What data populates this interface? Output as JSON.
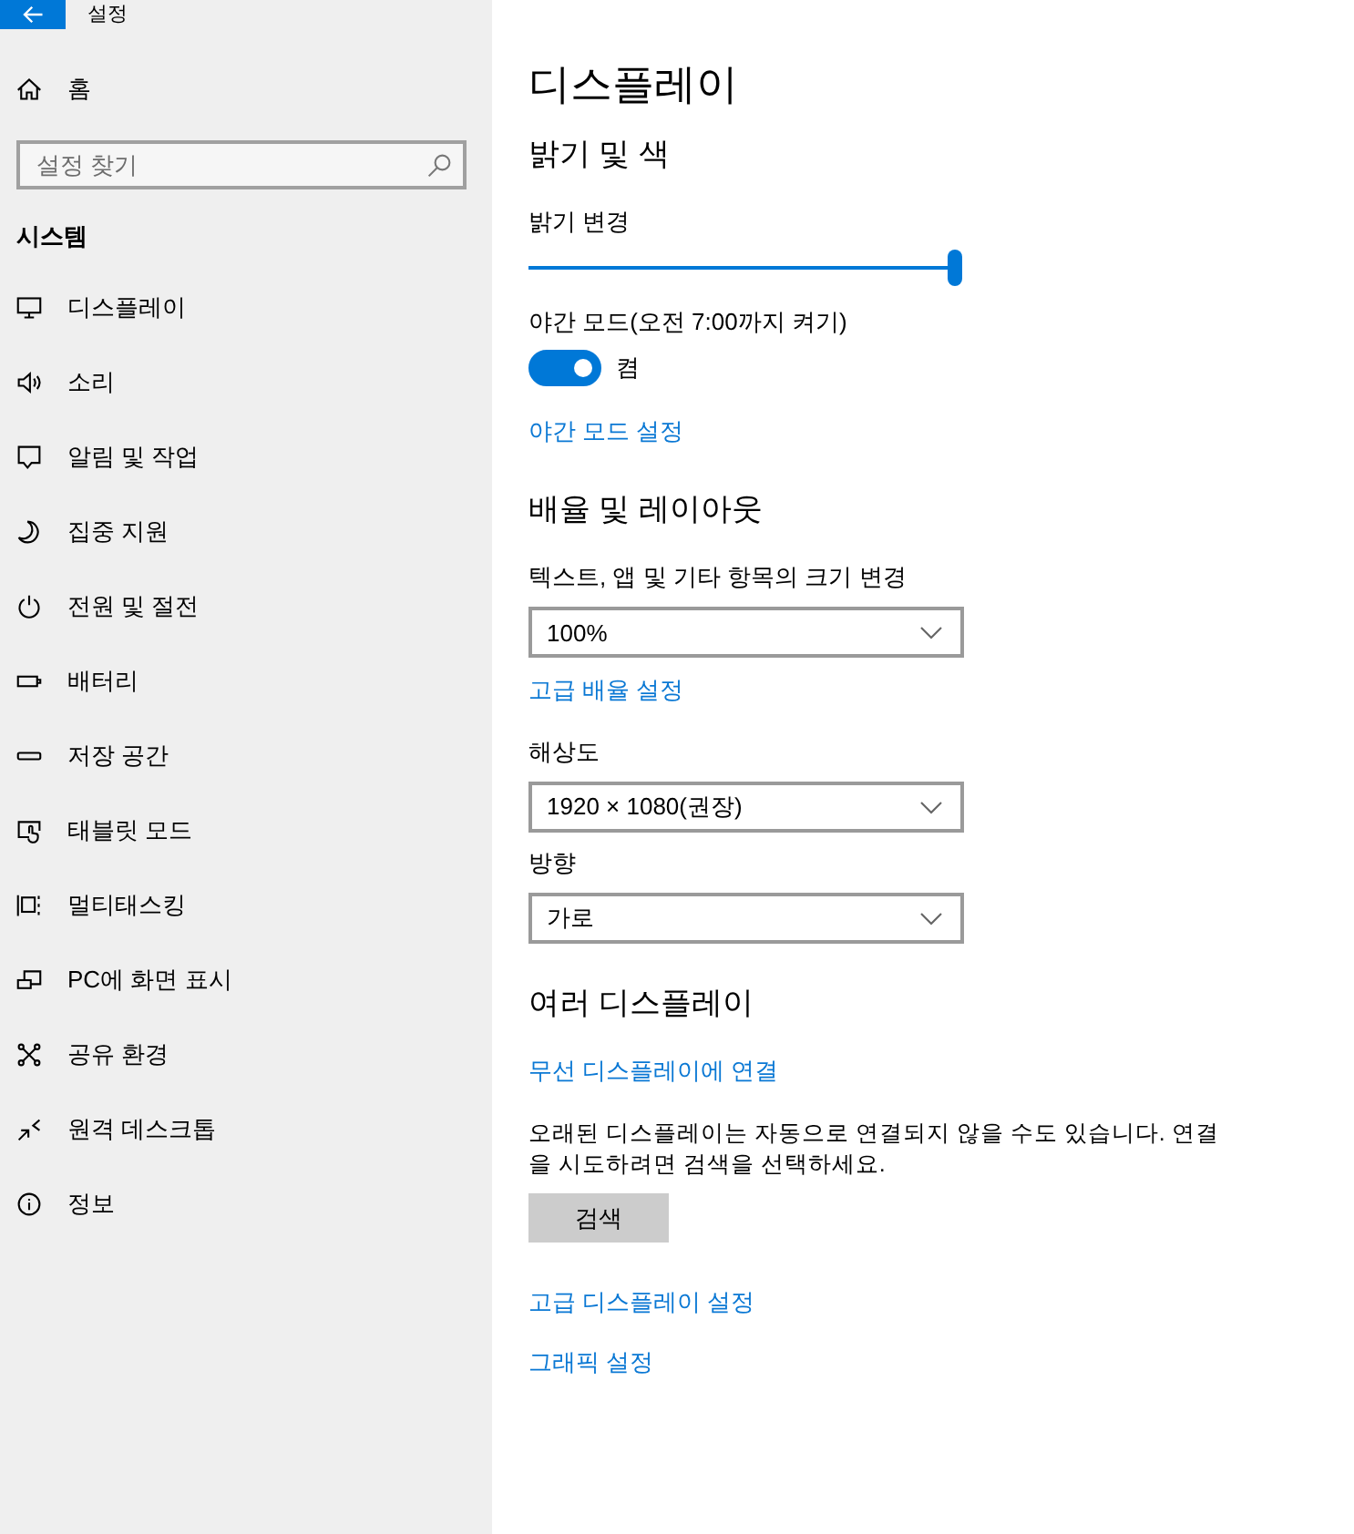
{
  "window": {
    "title": "설정"
  },
  "sidebar": {
    "home": "홈",
    "search": {
      "placeholder": "설정 찾기"
    },
    "section": "시스템",
    "items": [
      {
        "label": "디스플레이"
      },
      {
        "label": "소리"
      },
      {
        "label": "알림 및 작업"
      },
      {
        "label": "집중 지원"
      },
      {
        "label": "전원 및 절전"
      },
      {
        "label": "배터리"
      },
      {
        "label": "저장 공간"
      },
      {
        "label": "태블릿 모드"
      },
      {
        "label": "멀티태스킹"
      },
      {
        "label": "PC에 화면 표시"
      },
      {
        "label": "공유 환경"
      },
      {
        "label": "원격 데스크톱"
      },
      {
        "label": "정보"
      }
    ]
  },
  "page": {
    "title": "디스플레이",
    "sections": [
      {
        "heading": "밝기 및 색",
        "items": [
          {
            "kind": "slider",
            "label": "밝기 변경",
            "level": 1.0
          },
          {
            "kind": "toggle",
            "label": "야간 모드(오전 7:00까지 켜기)",
            "on": true,
            "state_text": "켬"
          },
          {
            "kind": "link",
            "text": "야간 모드 설정"
          }
        ]
      },
      {
        "heading": "배율 및 레이아웃",
        "items": [
          {
            "kind": "dropdown",
            "label": "텍스트, 앱 및 기타 항목의 크기 변경",
            "value": "100%"
          },
          {
            "kind": "link",
            "text": "고급 배율 설정"
          },
          {
            "kind": "dropdown",
            "label": "해상도",
            "value": "1920 × 1080(권장)"
          },
          {
            "kind": "dropdown",
            "label": "방향",
            "value": "가로"
          }
        ]
      },
      {
        "heading": "여러 디스플레이",
        "items": [
          {
            "kind": "link",
            "text": "무선 디스플레이에 연결"
          },
          {
            "kind": "paragraph",
            "text": "오래된 디스플레이는 자동으로 연결되지 않을 수도 있습니다. 연결을 시도하려면 검색을 선택하세요."
          },
          {
            "kind": "button",
            "text": "검색"
          },
          {
            "kind": "link",
            "text": "고급 디스플레이 설정"
          },
          {
            "kind": "link",
            "text": "그래픽 설정"
          }
        ]
      }
    ]
  }
}
